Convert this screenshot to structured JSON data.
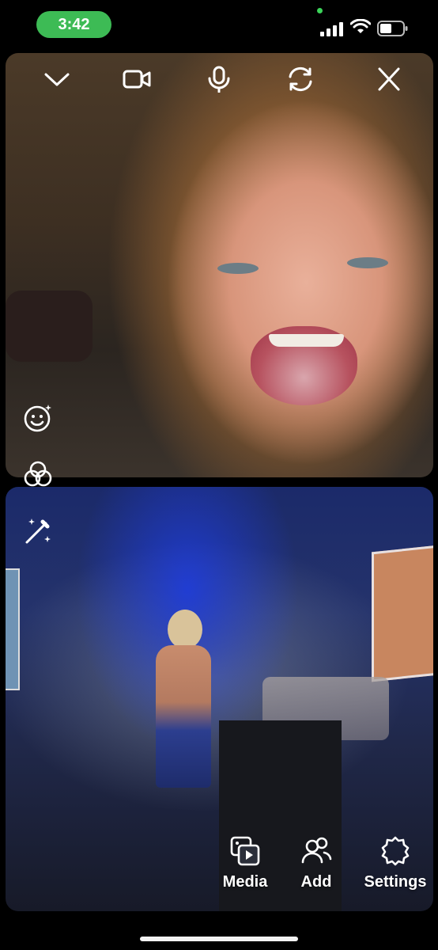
{
  "status_bar": {
    "time": "3:42",
    "time_pill_color": "#3dbb55",
    "icons": [
      "signal-icon",
      "wifi-icon",
      "battery-icon"
    ]
  },
  "call_controls": {
    "icons": [
      "chevron-down-icon",
      "video-camera-icon",
      "microphone-icon",
      "camera-flip-icon",
      "close-icon"
    ]
  },
  "side_tools": {
    "icons": [
      "face-effects-icon",
      "filters-icon",
      "magic-wand-icon"
    ]
  },
  "bottom_actions": [
    {
      "label": "Media",
      "icon": "media-icon"
    },
    {
      "label": "Add",
      "icon": "add-people-icon"
    },
    {
      "label": "Settings",
      "icon": "settings-gear-icon"
    }
  ]
}
